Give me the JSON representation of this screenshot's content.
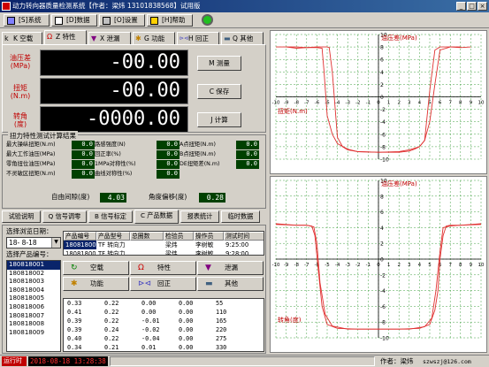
{
  "window": {
    "title": "动力转向器质量检测系统【作者：梁炜 13101838568】试用版"
  },
  "menu": [
    {
      "label": "[S]系统",
      "icon": "system-icon"
    },
    {
      "label": "[D]数据",
      "icon": "data-icon"
    },
    {
      "label": "[O]设置",
      "icon": "settings-icon"
    },
    {
      "label": "[H]帮助",
      "icon": "help-icon"
    }
  ],
  "tabs": [
    {
      "label": "K 空载",
      "icon": "k"
    },
    {
      "label": "Z 特性",
      "icon": "Ω"
    },
    {
      "label": "X 泄漏",
      "icon": "▼"
    },
    {
      "label": "G 功能",
      "icon": "✱"
    },
    {
      "label": "H 回正",
      "icon": "⊳⊲"
    },
    {
      "label": "Q 其他",
      "icon": "▬"
    }
  ],
  "readouts": [
    {
      "label_line1": "油压差",
      "label_line2": "(MPa)",
      "value": "-00.00"
    },
    {
      "label_line1": "扭矩",
      "label_line2": "(N.m)",
      "value": "-00.00"
    },
    {
      "label_line1": "转角",
      "label_line2": "(度)",
      "value": "-0000.00"
    }
  ],
  "buttons": {
    "measure": "M 测量",
    "save": "C 保存",
    "calc": "J 计算"
  },
  "results": {
    "title": "扭力特性测试计算结果",
    "rows": [
      [
        {
          "label": "最大操纵扭矩(N.m)",
          "value": "0.0"
        },
        {
          "label": "路感强度(N)",
          "value": "0.0"
        },
        {
          "label": "A点扭矩(N.m)",
          "value": "0.0"
        }
      ],
      [
        {
          "label": "最大工作油压(MPa)",
          "value": "0.0"
        },
        {
          "label": "回正率(%)",
          "value": "0.0"
        },
        {
          "label": "B点扭矩(N.m)",
          "value": "0.0"
        }
      ],
      [
        {
          "label": "零角扭位油压(MPa)",
          "value": "0.0"
        },
        {
          "label": "1MPa对称性(%)",
          "value": "0.0"
        },
        {
          "label": "DE扭矩差(N.m)",
          "value": "0.0"
        }
      ],
      [
        {
          "label": "不灵敏区扭矩(N.m)",
          "value": "0.0"
        },
        {
          "label": "曲线对称性(%)",
          "value": "0.0"
        },
        {
          "label": "",
          "value": ""
        }
      ]
    ],
    "free_gap_label": "自由间隙(度)",
    "free_gap_value": "4.03",
    "angle_offset_label": "角度偏移(度)",
    "angle_offset_value": "0.28"
  },
  "bottom_tabs": [
    "试验说明",
    "Q 信号调零",
    "B 信号标定",
    "C 产品数据",
    "报表统计",
    "临时数据"
  ],
  "query": {
    "date_label": "选择浏览日期：",
    "date_value": "18- 8-18",
    "product_label": "选择产品编号："
  },
  "product_list": [
    "180818001",
    "180818002",
    "180818003",
    "180818004",
    "180818005",
    "180818006",
    "180818007",
    "180818008",
    "180818009"
  ],
  "product_grid": {
    "headers": [
      "产品编号",
      "产品型号",
      "总圈数",
      "检验员",
      "操作员",
      "测试时间"
    ],
    "rows": [
      [
        "180818001",
        "TF 转向力",
        "",
        "梁炜",
        "李树敏",
        "9:25:00"
      ],
      [
        "180818002",
        "TF 转向力",
        "",
        "梁炜",
        "李树敏",
        "9:28:00"
      ]
    ]
  },
  "inner_buttons": [
    {
      "label": "空载",
      "icon": "↻"
    },
    {
      "label": "特性",
      "icon": "Ω"
    },
    {
      "label": "泄漏",
      "icon": "▼"
    },
    {
      "label": "功能",
      "icon": "✱"
    },
    {
      "label": "回正",
      "icon": "⊳⊲"
    },
    {
      "label": "其他",
      "icon": "▬"
    }
  ],
  "data_table": [
    [
      "0.33",
      "0.22",
      "0.00",
      "0.00",
      "55"
    ],
    [
      "0.41",
      "0.22",
      "0.00",
      "0.00",
      "110"
    ],
    [
      "0.39",
      "0.22",
      "-0.01",
      "0.00",
      "165"
    ],
    [
      "0.39",
      "0.24",
      "-0.02",
      "0.00",
      "220"
    ],
    [
      "0.40",
      "0.22",
      "-0.04",
      "0.00",
      "275"
    ],
    [
      "0.34",
      "0.21",
      "0.01",
      "0.00",
      "330"
    ]
  ],
  "status": {
    "left": "运行时",
    "datetime": "2018-08-18 13:28:38",
    "author": "作者：梁炜",
    "email": "szwszj@126.com"
  },
  "chart_data": [
    {
      "type": "line",
      "title": "",
      "ylabel": "油压差(MPa)",
      "xlabel": "扭矩(N.m)",
      "x_ticks": [
        -10,
        -9,
        -8,
        -7,
        -6,
        -5,
        -4,
        -3,
        -2,
        -1,
        0,
        1,
        2,
        3,
        4,
        5,
        6,
        7,
        8,
        9,
        10
      ],
      "xlim": [
        -10,
        10
      ],
      "ylim": [
        -10,
        10
      ],
      "y_ticks": [
        -10,
        -8,
        -6,
        -4,
        -2,
        0,
        2,
        4,
        6,
        8,
        10
      ],
      "grid": true,
      "series": [
        {
          "color": "#e03030",
          "x": [
            -10,
            -9,
            -8,
            -6,
            -5,
            -4.8,
            -4.5,
            -4,
            -3.5,
            -3,
            -2,
            0,
            2,
            3,
            3.5,
            4,
            4.5,
            5,
            5.5,
            6,
            7,
            8,
            9
          ],
          "y": [
            8,
            8,
            7.8,
            8,
            8,
            7.9,
            4,
            -6.5,
            -8,
            -8.5,
            -8.8,
            -8.9,
            -8.9,
            -8.7,
            -8.4,
            -8,
            -7,
            1,
            7.5,
            8,
            8,
            7.9,
            8
          ]
        },
        {
          "color": "#e03030",
          "x": [
            -9,
            -8,
            -7,
            -6,
            -5.5,
            -5.3,
            -5,
            -4.5,
            -4,
            -3,
            -2,
            0,
            2,
            3,
            4,
            4.5,
            5,
            5.5,
            6,
            7,
            8
          ],
          "y": [
            8,
            8,
            7.9,
            7.9,
            7.8,
            4,
            -3,
            -6,
            -7.5,
            -8.4,
            -8.8,
            -8.9,
            -8.8,
            -8.5,
            -8,
            -7,
            -4,
            2,
            7.5,
            8,
            8
          ]
        }
      ]
    },
    {
      "type": "line",
      "title": "",
      "ylabel": "油压差(MPa)",
      "xlabel": "转角(度)",
      "x_ticks": [
        -10,
        -9,
        -8,
        -7,
        -6,
        -5,
        -4,
        -3,
        -2,
        -1,
        0,
        1,
        2,
        3,
        4,
        5,
        6,
        7,
        8,
        9,
        10
      ],
      "xlim": [
        -10,
        10
      ],
      "ylim": [
        -10,
        10
      ],
      "y_ticks": [
        -10,
        -8,
        -6,
        -4,
        -2,
        0,
        2,
        4,
        6,
        8,
        10
      ],
      "grid": true,
      "series": [
        {
          "color": "#e03030",
          "x": [
            -10,
            -9,
            -8,
            -7,
            -6.5,
            -6.2,
            -5.9,
            -5.5,
            -5,
            -4,
            -2,
            0,
            2,
            4,
            5,
            5.5,
            5.8,
            6,
            6.3,
            6.6,
            7,
            8,
            9,
            10
          ],
          "y": [
            4.5,
            4.4,
            4.3,
            4.3,
            4.2,
            3,
            -1,
            -6,
            -8.3,
            -8.8,
            -8.9,
            -8.9,
            -8.9,
            -8.8,
            -8.3,
            -6.5,
            -4,
            0,
            3,
            4.2,
            4.3,
            4.3,
            4.4,
            4.5
          ]
        },
        {
          "color": "#e03030",
          "x": [
            -10,
            -8,
            -7,
            -6.3,
            -6,
            -5.7,
            -5.2,
            -4.5,
            -3,
            0,
            3,
            4.5,
            5.2,
            5.6,
            6,
            6.3,
            7,
            8,
            10
          ],
          "y": [
            4.4,
            4.3,
            4.3,
            4.1,
            2,
            -3,
            -7,
            -8.5,
            -8.9,
            -8.9,
            -8.9,
            -8.6,
            -7.5,
            -4,
            1,
            4,
            4.2,
            4.3,
            4.4
          ]
        }
      ]
    }
  ]
}
